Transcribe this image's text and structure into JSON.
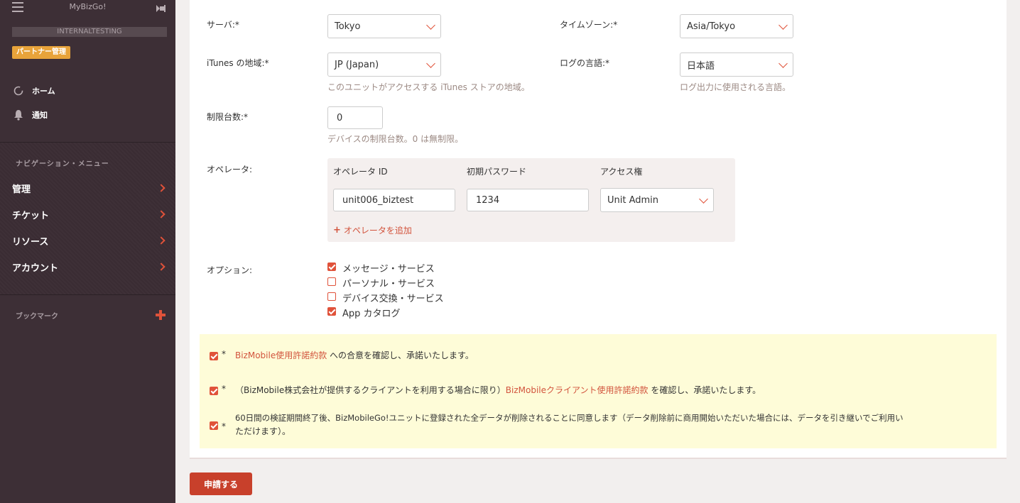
{
  "sidebar": {
    "brand": "MyBizGo!",
    "env_label": "INTERNALTESTING",
    "partner_badge": "パートナー管理",
    "home_label": "ホーム",
    "notify_label": "通知",
    "nav_heading": "ナビゲーション・メニュー",
    "nav_items": [
      "管理",
      "チケット",
      "リソース",
      "アカウント"
    ],
    "bookmark_label": "ブックマーク"
  },
  "form": {
    "server_label": "サーバ:*",
    "server_value": "Tokyo",
    "timezone_label": "タイムゾーン:*",
    "timezone_value": "Asia/Tokyo",
    "itunes_label": "iTunes の地域:*",
    "itunes_value": "JP (Japan)",
    "itunes_help": "このユニットがアクセスする iTunes ストアの地域。",
    "loglang_label": "ログの言語:*",
    "loglang_value": "日本語",
    "loglang_help": "ログ出力に使用される言語。",
    "limit_label": "制限台数:*",
    "limit_value": "0",
    "limit_help": "デバイスの制限台数。0 は無制限。",
    "operator_label": "オペレータ:",
    "operator": {
      "col_id": "オペレータ ID",
      "col_password": "初期パスワード",
      "col_access": "アクセス権",
      "id_value": "unit006_biztest",
      "password_value": "1234",
      "access_value": "Unit Admin",
      "add_label": "オペレータを追加"
    },
    "options_label": "オプション:",
    "options": [
      {
        "label": "メッセージ・サービス",
        "checked": true
      },
      {
        "label": "パーソナル・サービス",
        "checked": false
      },
      {
        "label": "デバイス交換・サービス",
        "checked": false
      },
      {
        "label": "App カタログ",
        "checked": true
      }
    ]
  },
  "agreements": {
    "star": "*",
    "a1_link": "BizMobile使用許諾約款",
    "a1_text": " への合意を確認し、承諾いたします。",
    "a2_prefix": "（BizMobile株式会社が提供するクライアントを利用する場合に限り）",
    "a2_link": "BizMobileクライアント使用許諾約款",
    "a2_text": " を確認し、承諾いたします。",
    "a3_line1": "60日間の検証期間終了後、BizMobileGo!ユニットに登録された全データが削除されることに同意します（データ削除前に商用開始いただいた場合には、データを引き継いでご利用い",
    "a3_line2": "ただけます）。"
  },
  "submit_label": "申請する",
  "colors": {
    "accent": "#e0523a",
    "sidebar_bg": "#3d2f36",
    "badge": "#e8a33a",
    "agree_bg": "#fefcd8",
    "submit": "#c8402b"
  }
}
